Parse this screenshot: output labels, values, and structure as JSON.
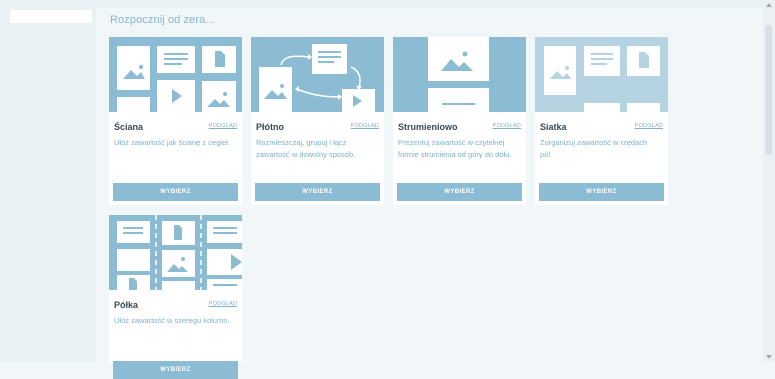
{
  "heading": "Rozpocznij od zera...",
  "cards": [
    {
      "title": "Ściana",
      "preview": "PODGLĄD",
      "description": "Ułóż zawartość jak ścianę z cegieł.",
      "button": "WYBIERZ"
    },
    {
      "title": "Płótno",
      "preview": "PODGLĄD",
      "description": "Rozmieszczaj, grupuj i łącz zawartość w dowolny sposób.",
      "button": "WYBIERZ"
    },
    {
      "title": "Strumieniowo",
      "preview": "PODGLĄD",
      "description": "Prezentuj zawartość w czytelnej formie strumienia od góry do dołu.",
      "button": "WYBIERZ"
    },
    {
      "title": "Siatka",
      "preview": "PODGLĄD",
      "description": "Zorganizuj zawartość w rzędach pól.",
      "button": "WYBIERZ"
    },
    {
      "title": "Półka",
      "preview": "PODGLĄD",
      "description": "Ułóż zawartość w szeregu kolumn.",
      "button": "WYBIERZ"
    }
  ],
  "colors": {
    "accent": "#8bbcd3",
    "background": "#f1f6f9",
    "title_text": "#3a4a55",
    "muted_text": "#7fb0c9"
  },
  "icons": [
    "image-placeholder-icon",
    "text-block-icon",
    "play-icon",
    "document-icon"
  ]
}
